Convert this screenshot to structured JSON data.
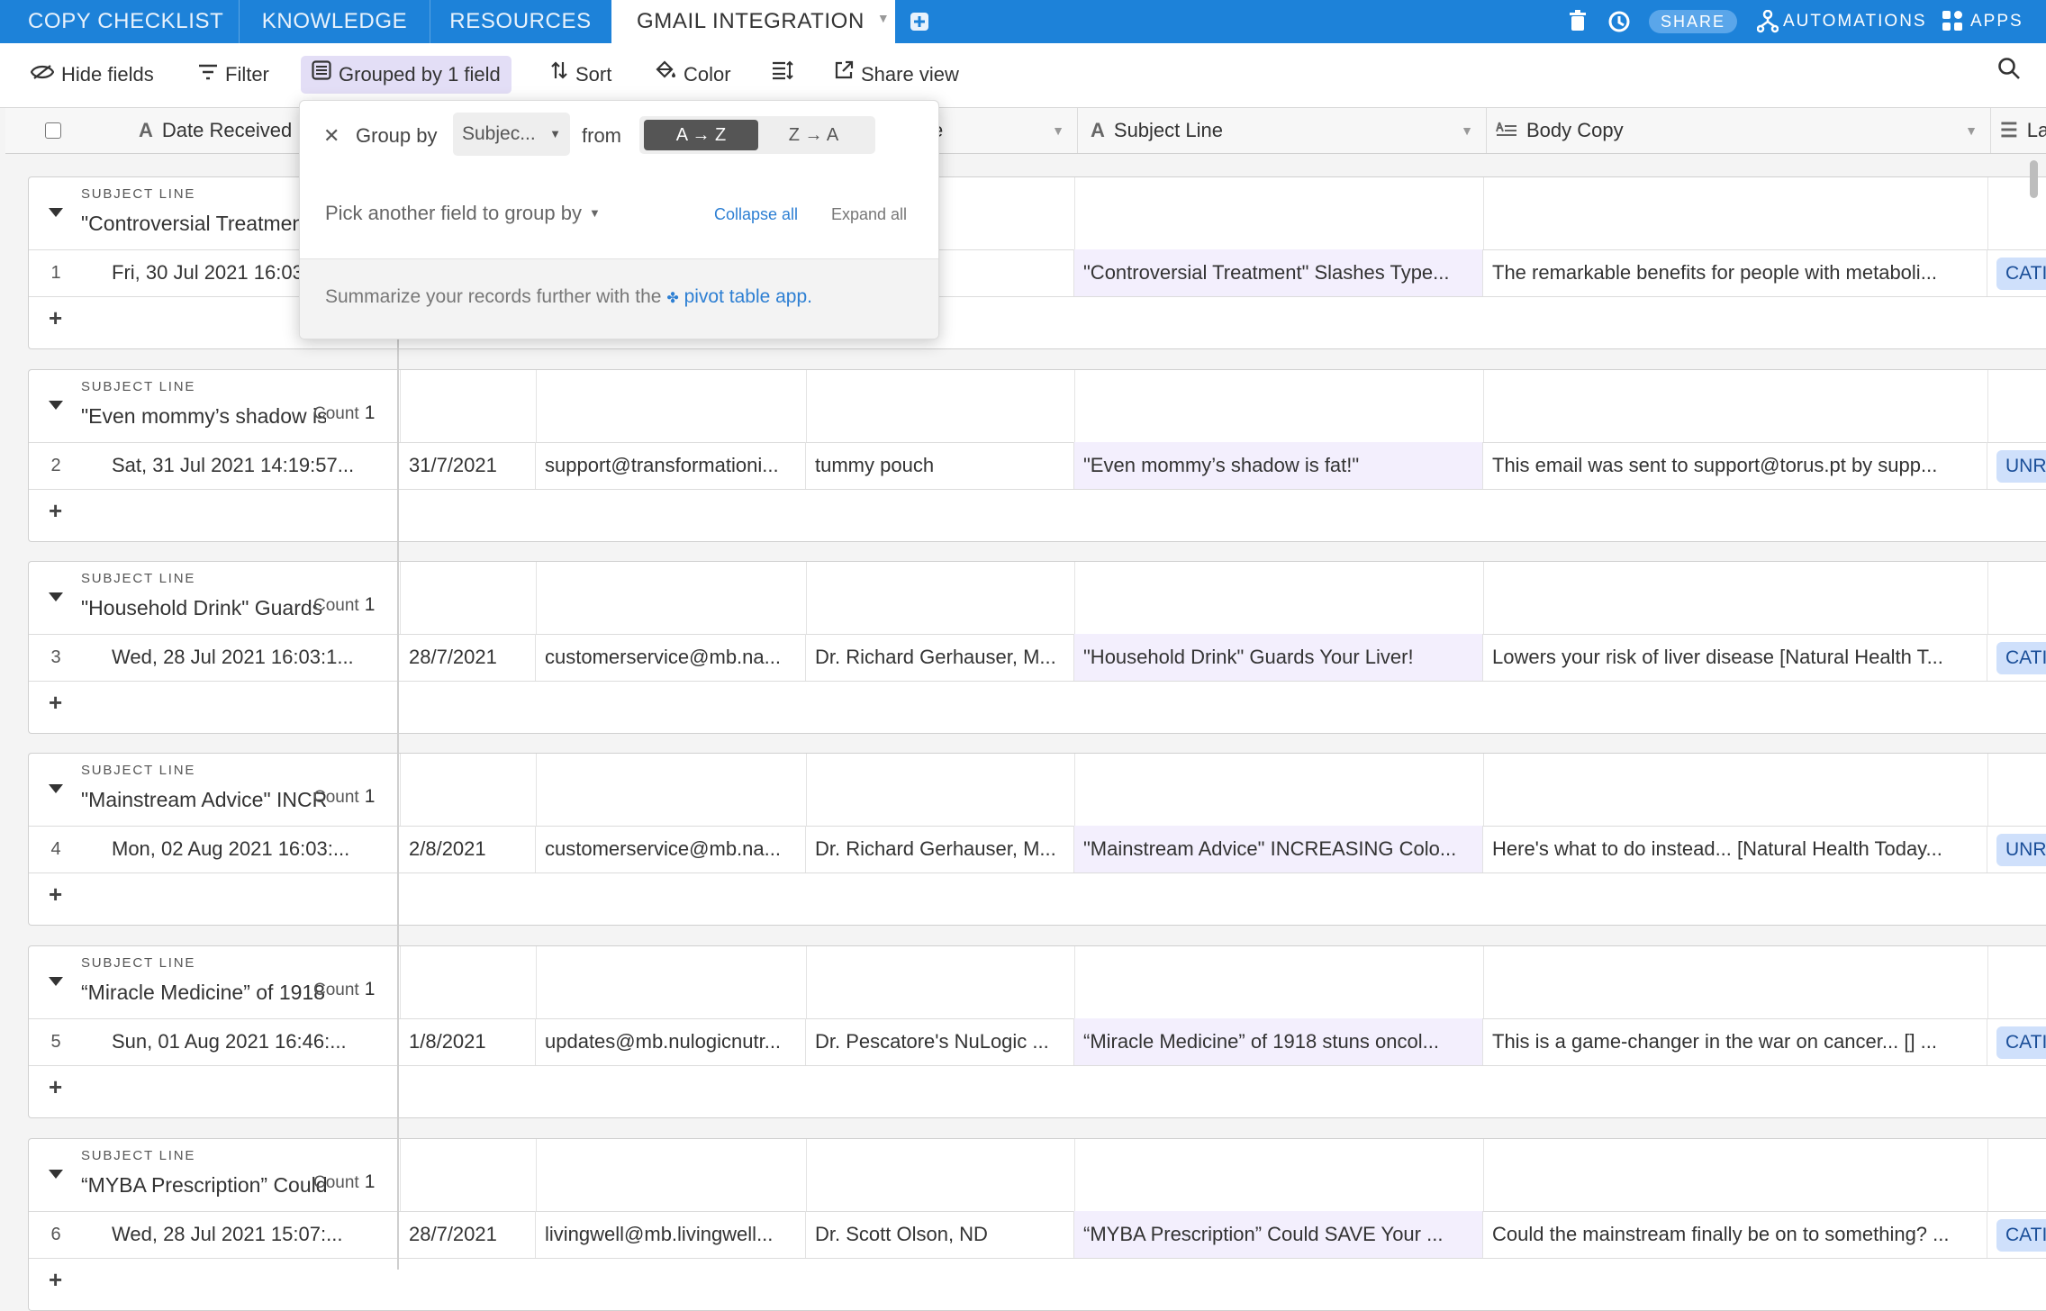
{
  "tabs": [
    {
      "label": "COPY CHECKLIST"
    },
    {
      "label": "KNOWLEDGE"
    },
    {
      "label": "RESOURCES"
    },
    {
      "label": "GMAIL INTEGRATION"
    }
  ],
  "topbar": {
    "share": "SHARE",
    "automations": "AUTOMATIONS",
    "apps": "APPS"
  },
  "toolbar": {
    "hide_fields": "Hide fields",
    "filter": "Filter",
    "grouped": "Grouped by 1 field",
    "sort": "Sort",
    "color": "Color",
    "share_view": "Share view"
  },
  "columns": [
    {
      "label": "Date Received",
      "icon": "text-field-icon"
    },
    {
      "label": "e",
      "icon": ""
    },
    {
      "label": "Subject Line",
      "icon": "text-field-icon"
    },
    {
      "label": "Body Copy",
      "icon": "long-text-icon"
    },
    {
      "label": "La",
      "icon": "list-icon"
    }
  ],
  "group_label": "SUBJECT LINE",
  "count_label": "Count",
  "groups": [
    {
      "title": "\"Controversial Treatment\" Slashes Type...",
      "count": "",
      "row": {
        "num": "1",
        "date": "Fri, 30 Jul 2021 16:03:...",
        "day": "",
        "email": "",
        "sender": "erhauser, M...",
        "subject": "\"Controversial Treatment\" Slashes Type...",
        "body": "The remarkable benefits for people with metaboli...",
        "label": "CATI"
      }
    },
    {
      "title": "\"Even mommy’s shadow is fat!\"",
      "count": "1",
      "row": {
        "num": "2",
        "date": "Sat, 31 Jul 2021 14:19:57...",
        "day": "31/7/2021",
        "email": "support@transformationi...",
        "sender": "tummy pouch",
        "subject": "\"Even mommy’s shadow is fat!\"",
        "body": "This email was sent to support@torus.pt by supp...",
        "label": "UNR"
      }
    },
    {
      "title": "\"Household Drink\" Guards Your Liver!",
      "count": "1",
      "row": {
        "num": "3",
        "date": "Wed, 28 Jul 2021 16:03:1...",
        "day": "28/7/2021",
        "email": "customerservice@mb.na...",
        "sender": "Dr. Richard Gerhauser, M...",
        "subject": "\"Household Drink\" Guards Your Liver!",
        "body": "Lowers your risk of liver disease [Natural Health T...",
        "label": "CATI"
      }
    },
    {
      "title": "\"Mainstream Advice\" INCREASING Colo...",
      "count": "1",
      "row": {
        "num": "4",
        "date": "Mon, 02 Aug 2021 16:03:...",
        "day": "2/8/2021",
        "email": "customerservice@mb.na...",
        "sender": "Dr. Richard Gerhauser, M...",
        "subject": "\"Mainstream Advice\" INCREASING Colo...",
        "body": "Here's what to do instead... [Natural Health Today...",
        "label": "UNR"
      }
    },
    {
      "title": "“Miracle Medicine” of 1918 stuns oncol...",
      "count": "1",
      "row": {
        "num": "5",
        "date": "Sun, 01 Aug 2021 16:46:...",
        "day": "1/8/2021",
        "email": "updates@mb.nulogicnutr...",
        "sender": "Dr. Pescatore's NuLogic ...",
        "subject": "“Miracle Medicine” of 1918 stuns oncol...",
        "body": "This is a game-changer in the war on cancer... [] ...",
        "label": "CATI"
      }
    },
    {
      "title": "“MYBA Prescription” Could SAVE Your ...",
      "count": "1",
      "row": {
        "num": "6",
        "date": "Wed, 28 Jul 2021 15:07:...",
        "day": "28/7/2021",
        "email": "livingwell@mb.livingwell...",
        "sender": "Dr. Scott Olson, ND",
        "subject": "“MYBA Prescription” Could SAVE Your ...",
        "body": "Could the mainstream finally be on to something? ...",
        "label": "CATI"
      }
    }
  ],
  "popover": {
    "group_by": "Group by",
    "field": "Subjec...",
    "from": "from",
    "asc": "A → Z",
    "desc": "Z → A",
    "pick": "Pick another field to group by",
    "collapse": "Collapse all",
    "expand": "Expand all",
    "footer_text": "Summarize your records further with the",
    "footer_link": "pivot table app."
  }
}
